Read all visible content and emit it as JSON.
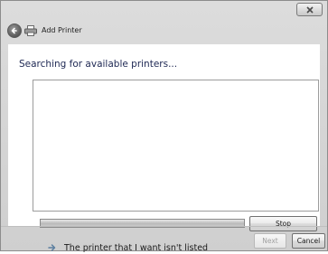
{
  "window": {
    "title": "Add Printer",
    "close_icon": "close-icon",
    "back_icon": "back-arrow-icon",
    "app_icon": "printer-icon"
  },
  "content": {
    "heading": "Searching for available printers...",
    "progress_fraction": 1.0,
    "stop_label": "Stop",
    "link_text": "The printer that I want isn't listed",
    "link_icon": "arrow-right-icon"
  },
  "footer": {
    "next_label": "Next",
    "next_enabled": false,
    "cancel_label": "Cancel"
  }
}
